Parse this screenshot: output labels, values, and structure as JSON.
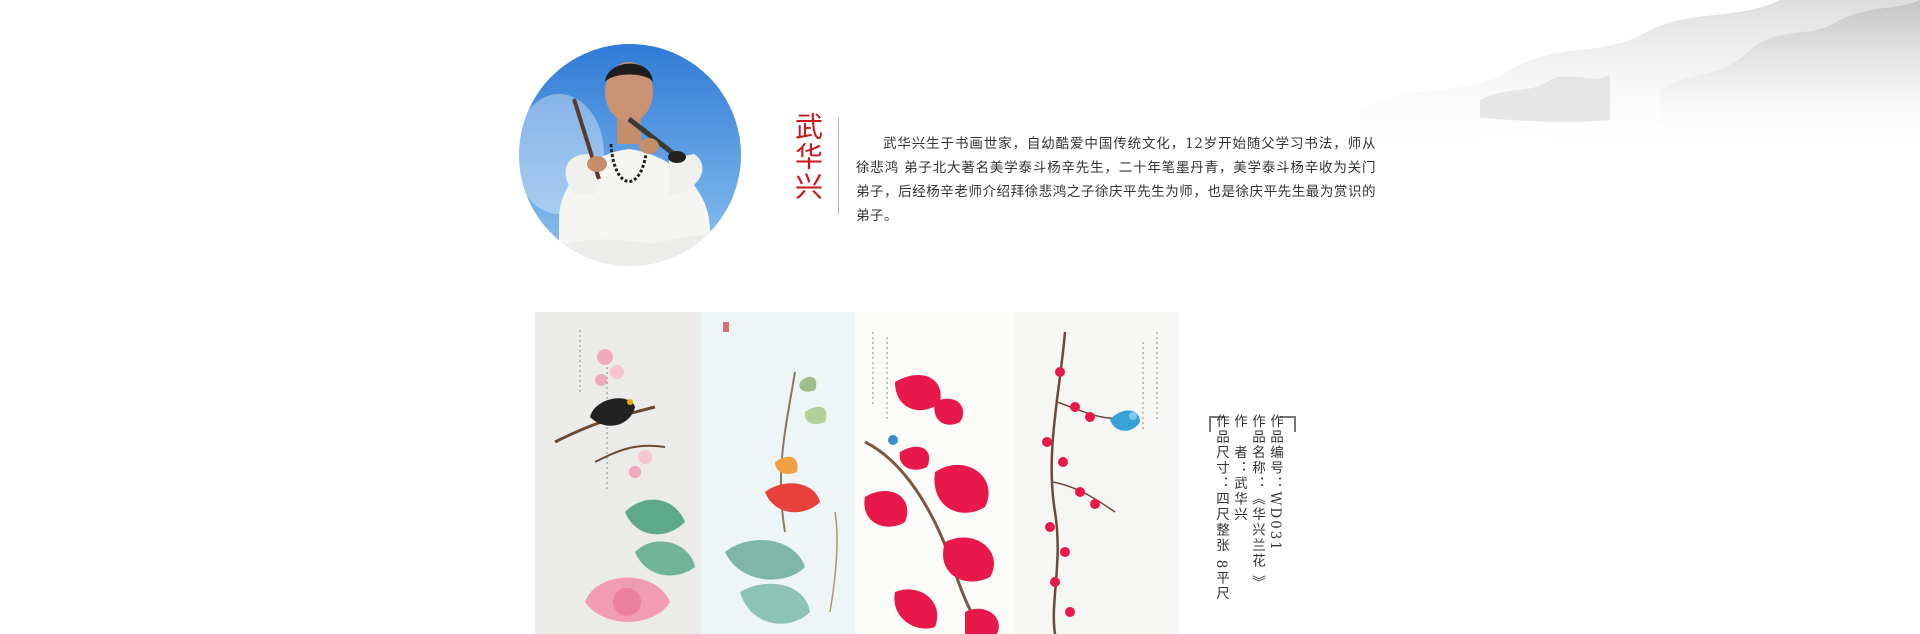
{
  "artist": {
    "name": "武华兴",
    "bio": "武华兴生于书画世家，自幼酷爱中国传统文化，12岁开始随父学习书法，师从徐悲鸿 弟子北大著名美学泰斗杨辛先生，二十年笔墨丹青，美学泰斗杨辛收为关门弟子，后经杨辛老师介绍拜徐悲鸿之子徐庆平先生为师，也是徐庆平先生最为赏识的弟子。"
  },
  "artwork": {
    "number_label": "作品编号：",
    "number_value": "WD031",
    "title_label": "作品名称：",
    "title_value": "《华兴兰花 》",
    "author_label": "作　者：",
    "author_value": "武华兴",
    "size_label": "作品尺寸：",
    "size_value": "四尺整张 8平尺"
  },
  "colors": {
    "accent_red": "#c8161d",
    "blossom_red": "#e8184a",
    "pink": "#f2a9c0",
    "leaf_green": "#6fb39a"
  },
  "icons": {
    "corner_left": "bracket-corner-icon",
    "corner_right": "bracket-corner-icon"
  }
}
